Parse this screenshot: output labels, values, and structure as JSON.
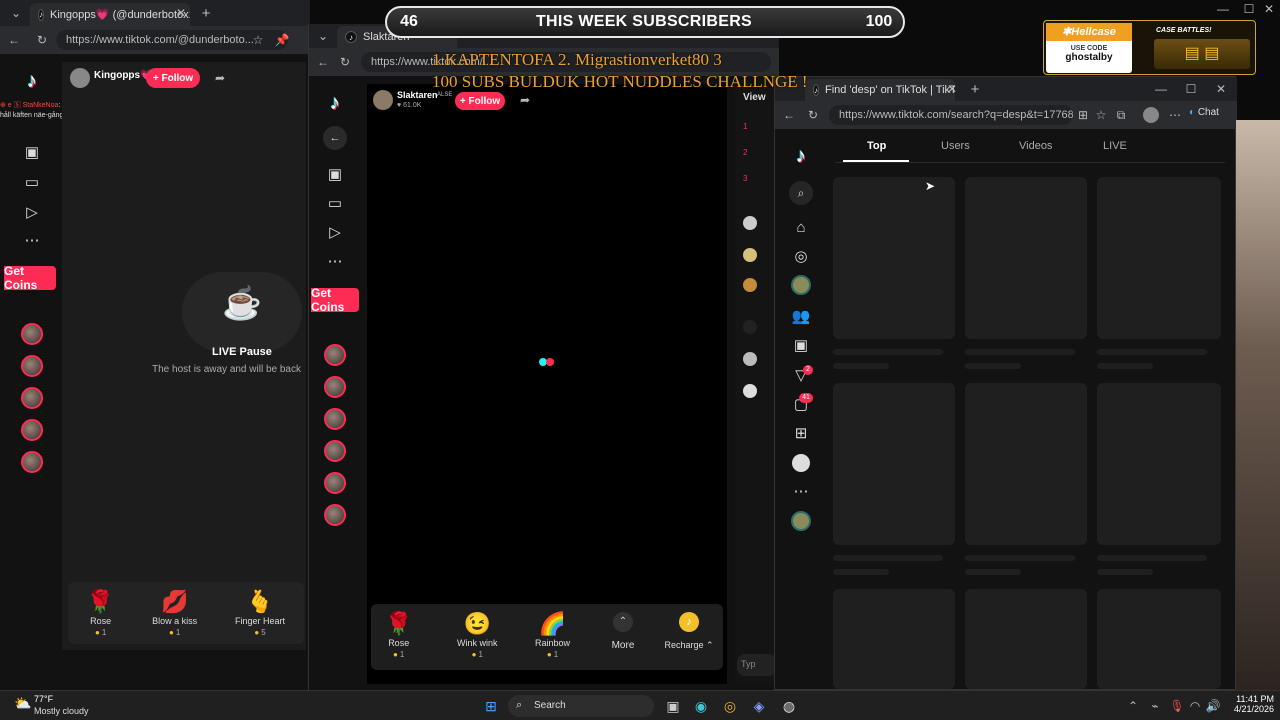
{
  "window1": {
    "tab_title": "Kingopps💗 (@dunderbotox1) is L",
    "url": "https://www.tiktok.com/@dunderboto...",
    "username": "Kingopps💗",
    "follow": "+ Follow",
    "chat_msg": ": ja e din pappa sätt dig ner å håll käften näe-gång",
    "get_coins": "Get Coins",
    "pause_title": "LIVE Pause",
    "pause_sub": "The host is away and will be back",
    "gifts": [
      {
        "name": "Rose",
        "icon": "🌹",
        "cost": "1"
      },
      {
        "name": "Blow a kiss",
        "icon": "💋",
        "cost": "1"
      },
      {
        "name": "Finger Heart",
        "icon": "🫰",
        "cost": "5"
      }
    ]
  },
  "window2": {
    "tab_title": "Slaktaren",
    "url": "https://www.tiktok.com/...",
    "username": "Slaktaren",
    "badge": "ALSE",
    "likes": "61.0K",
    "follow": "+ Follow",
    "get_coins": "Get Coins",
    "gifts": [
      {
        "name": "Rose",
        "icon": "🌹",
        "cost": "1"
      },
      {
        "name": "Wink wink",
        "icon": "😉",
        "cost": "1"
      },
      {
        "name": "Rainbow",
        "icon": "🌈",
        "cost": "1"
      }
    ],
    "more": "More",
    "recharge": "Recharge"
  },
  "window3": {
    "tab_title": "Find 'desp' on TikTok | TikTok Sear",
    "url": "https://www.tiktok.com/search?q=desp&t=1776804...",
    "chat_label": "Chat",
    "tabs": [
      "Top",
      "Users",
      "Videos",
      "LIVE"
    ],
    "active_tab": "Top",
    "badge_inbox": "2",
    "badge_messages": "41",
    "side_label": "View"
  },
  "overlay": {
    "current": "46",
    "title": "THIS WEEK SUBSCRIBERS",
    "goal": "100",
    "goals_line1": "1.KAPTENTOFA    2. Migrastionverket80   3",
    "goals_line2": "100 SUBS BULDUK HOT NUDDLES CHALLNGE !"
  },
  "sponsor": {
    "brand": "Hellcase",
    "use_code": "USE CODE",
    "code": "ghostalby",
    "promo": "CASE BATTLES!"
  },
  "taskbar": {
    "temp": "77°F",
    "weather": "Mostly cloudy",
    "search": "Search",
    "time": "11:41 PM",
    "date": "4/21/2026"
  },
  "colors": {
    "accent": "#fe2c55",
    "cyan": "#25f4ee",
    "gold": "#f0a030"
  }
}
